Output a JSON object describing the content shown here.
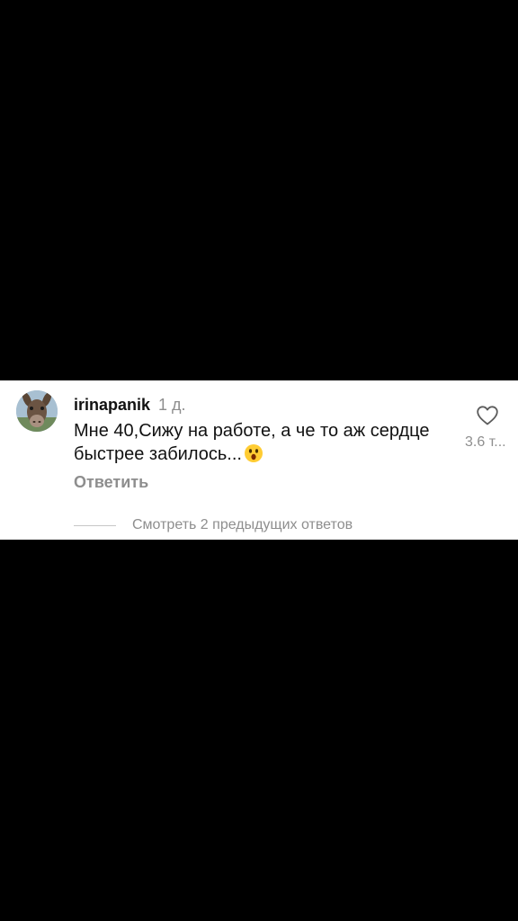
{
  "comment": {
    "username": "irinapanik",
    "timestamp": "1 д.",
    "text": "Мне 40,Сижу на работе, а че то аж сердце быстрее забилось...",
    "emoji": "😮",
    "reply_label": "Ответить",
    "like_count": "3.6 т...",
    "avatar_icon": "donkey-avatar",
    "like_icon": "heart-outline-icon"
  },
  "replies": {
    "label": "Смотреть 2 предыдущих ответов"
  },
  "colors": {
    "background": "#000000",
    "card": "#ffffff",
    "text": "#111111",
    "muted": "#8e8e8e"
  }
}
